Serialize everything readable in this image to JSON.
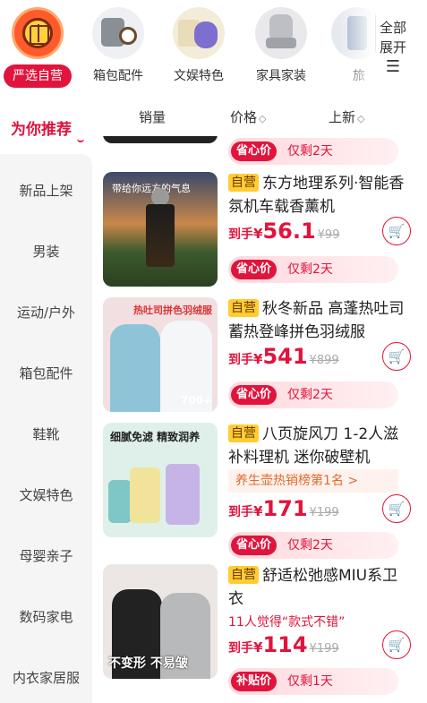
{
  "top_categories": [
    {
      "label": "严选自营",
      "icon": "jd-logo-icon",
      "active": true
    },
    {
      "label": "箱包配件",
      "icon": "bag-watch-icon"
    },
    {
      "label": "文娱特色",
      "icon": "toy-figure-icon"
    },
    {
      "label": "家具家装",
      "icon": "chair-icon"
    },
    {
      "label": "旅",
      "icon": "travel-icon"
    }
  ],
  "expand": {
    "line1": "全部",
    "line2": "展开",
    "icon": "menu-icon"
  },
  "sidebar": {
    "header": "为你推荐",
    "items": [
      "新品上架",
      "男装",
      "运动/户外",
      "箱包配件",
      "鞋靴",
      "文娱特色",
      "母婴亲子",
      "数码家电",
      "内衣家居服"
    ]
  },
  "sort": {
    "sales": "销量",
    "price": "价格",
    "new": "上新"
  },
  "products": [
    {
      "promo_left": "省心价",
      "promo_right": "仅剩2天"
    },
    {
      "tag": "自营",
      "title": "东方地理系列·智能香氛机车载香薰机",
      "pre": "到手",
      "yen": "¥",
      "price": "56.1",
      "orig": "¥99",
      "promo_left": "省心价",
      "promo_right": "仅剩2天",
      "thumb_text": "带给你远方的气息"
    },
    {
      "tag": "自营",
      "title": "秋冬新品 高蓬热吐司蓄热登峰拼色羽绒服",
      "pre": "到手",
      "yen": "¥",
      "price": "541",
      "orig": "¥899",
      "promo_left": "省心价",
      "promo_right": "仅剩2天",
      "thumb_text": "热吐司拼色羽绒服",
      "thumb_badge": "700+"
    },
    {
      "tag": "自营",
      "title": "八页旋风刀 1-2人滋补料理机 迷你破壁机",
      "rank": "养生壶热销榜第1名 >",
      "pre": "到手",
      "yen": "¥",
      "price": "171",
      "orig": "¥199",
      "promo_left": "省心价",
      "promo_right": "仅剩2天",
      "thumb_text": "细腻免滤 精致润养"
    },
    {
      "tag": "自营",
      "title": "舒适松弛感MIU系卫衣",
      "sub": "11人觉得“款式不错”",
      "pre": "到手",
      "yen": "¥",
      "price": "114",
      "orig": "¥199",
      "promo_left": "补贴价",
      "promo_right": "仅剩1天",
      "thumb_text": "不变形 不易皱"
    }
  ],
  "colors": {
    "accent": "#e0143c",
    "selftag": "#ffcc33"
  }
}
